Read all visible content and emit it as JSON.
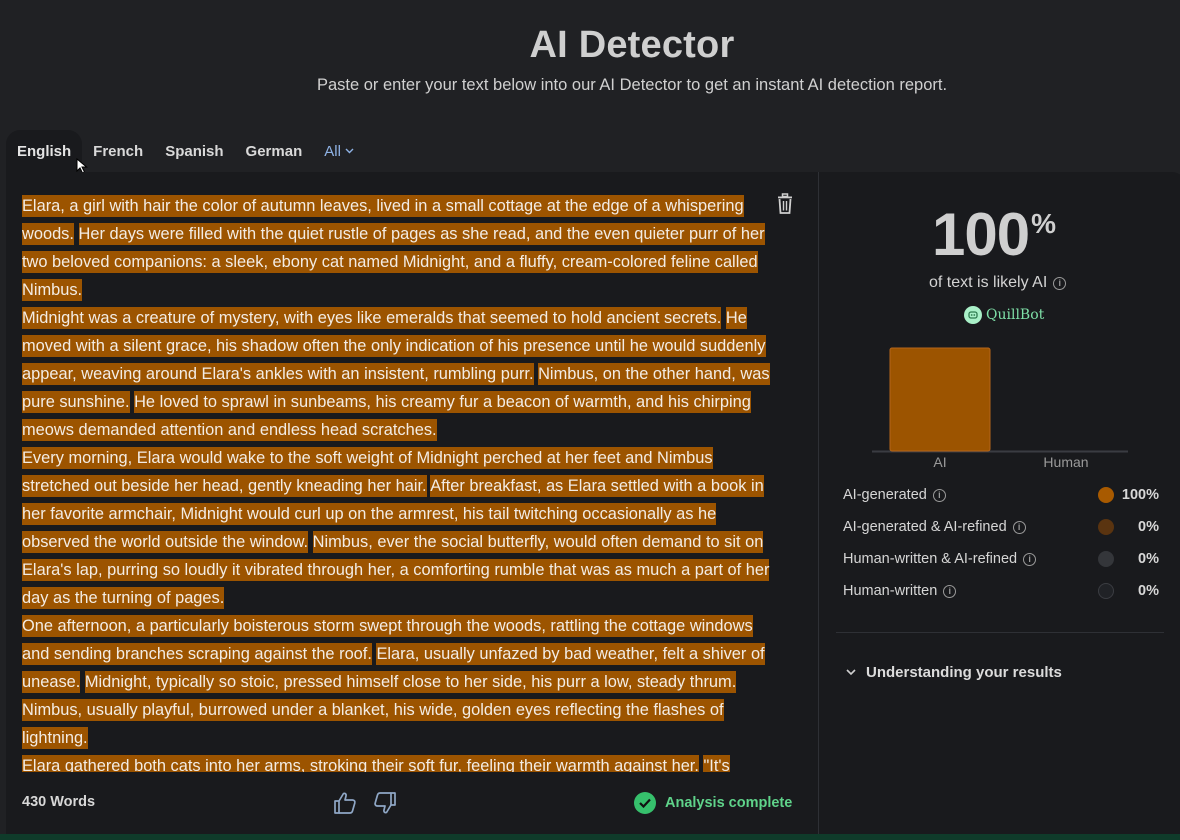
{
  "header": {
    "title": "AI Detector",
    "subtitle": "Paste or enter your text below into our AI Detector to get an instant AI detection report."
  },
  "tabs": [
    {
      "label": "English",
      "active": true
    },
    {
      "label": "French",
      "active": false
    },
    {
      "label": "Spanish",
      "active": false
    },
    {
      "label": "German",
      "active": false
    },
    {
      "label": "All",
      "active": false
    }
  ],
  "editor": {
    "paragraphs": [
      [
        "Elara, a girl with hair the color of autumn leaves, lived in a small cottage at the edge of a whispering woods.",
        "Her days were filled with the quiet rustle of pages as she read, and the even quieter purr of her two beloved companions: a sleek, ebony cat named Midnight, and a fluffy, cream-colored feline called Nimbus."
      ],
      [
        "Midnight was a creature of mystery, with eyes like emeralds that seemed to hold ancient secrets.",
        "He moved with a silent grace, his shadow often the only indication of his presence until he would suddenly appear, weaving around Elara's ankles with an insistent, rumbling purr.",
        "Nimbus, on the other hand, was pure sunshine.",
        "He loved to sprawl in sunbeams, his creamy fur a beacon of warmth, and his chirping meows demanded attention and endless head scratches."
      ],
      [
        "Every morning, Elara would wake to the soft weight of Midnight perched at her feet and Nimbus stretched out beside her head, gently kneading her hair.",
        "After breakfast, as Elara settled with a book in her favorite armchair, Midnight would curl up on the armrest, his tail twitching occasionally as he observed the world outside the window.",
        "Nimbus, ever the social butterfly, would often demand to sit on Elara's lap, purring so loudly it vibrated through her, a comforting rumble that was as much a part of her day as the turning of pages."
      ],
      [
        "One afternoon, a particularly boisterous storm swept through the woods, rattling the cottage windows and sending branches scraping against the roof.",
        "Elara, usually unfazed by bad weather, felt a shiver of unease.",
        "Midnight, typically so stoic, pressed himself close to her side, his purr a low, steady thrum.",
        "Nimbus, usually playful, burrowed under a blanket, his wide, golden eyes reflecting the flashes of lightning."
      ],
      [
        "Elara gathered both cats into her arms, stroking their soft fur, feeling their warmth against her.",
        "\"It's"
      ]
    ]
  },
  "footer": {
    "word_count": "430 Words",
    "status": "Analysis complete"
  },
  "result": {
    "percent": "100",
    "percent_sign": "%",
    "likely_label": "of text is likely AI",
    "brand": "QuillBot",
    "breakdown": [
      {
        "label": "AI-generated",
        "value": "100%",
        "color": "#a85a00"
      },
      {
        "label": "AI-generated & AI-refined",
        "value": "0%",
        "color": "#5a3410"
      },
      {
        "label": "Human-written & AI-refined",
        "value": "0%",
        "color": "#34363a"
      },
      {
        "label": "Human-written",
        "value": "0%",
        "color": "#202226"
      }
    ],
    "understanding_label": "Understanding your results"
  },
  "chart_data": {
    "type": "bar",
    "categories": [
      "AI",
      "Human"
    ],
    "values": [
      100,
      0
    ],
    "colors": [
      "#9c5400",
      "#9c5400"
    ],
    "ylim": [
      0,
      100
    ],
    "title": "",
    "xlabel": "",
    "ylabel": ""
  }
}
